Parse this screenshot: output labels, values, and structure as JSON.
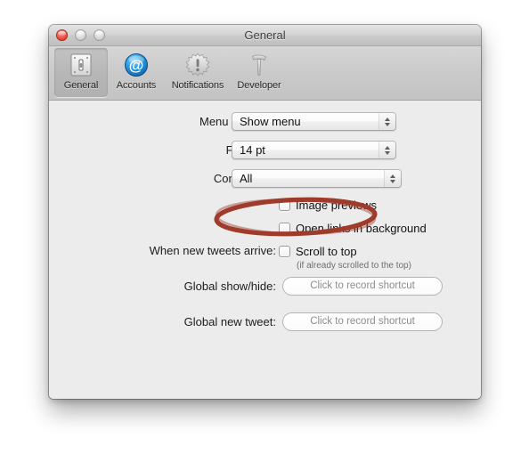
{
  "window": {
    "title": "General",
    "traffic_lights": [
      {
        "name": "close",
        "color": "#d63a2c",
        "enabled": true
      },
      {
        "name": "minimize",
        "color": "#c6c6c6",
        "enabled": false
      },
      {
        "name": "zoom",
        "color": "#c6c6c6",
        "enabled": false
      }
    ]
  },
  "toolbar": {
    "items": [
      {
        "label": "General",
        "icon": "light-switch-icon",
        "selected": true
      },
      {
        "label": "Accounts",
        "icon": "at-sign-icon",
        "selected": false
      },
      {
        "label": "Notifications",
        "icon": "badge-exclamation-icon",
        "selected": false
      },
      {
        "label": "Developer",
        "icon": "hammer-icon",
        "selected": false
      }
    ]
  },
  "form": {
    "menu_bar_icon": {
      "label": "Menu bar icon:",
      "value": "Show menu",
      "options": [
        "Show menu"
      ]
    },
    "font_size": {
      "label": "Font size:",
      "value": "14 pt",
      "options": [
        "14 pt"
      ]
    },
    "connect_tab": {
      "label": "Connect tab",
      "value": "All",
      "options": [
        "All"
      ]
    },
    "image_previews": {
      "label": "Image previews",
      "checked": false
    },
    "open_links_background": {
      "label": "Open links in background",
      "checked": false
    },
    "new_tweets": {
      "label": "When new tweets arrive:",
      "checkbox_label": "Scroll to top",
      "checked": false,
      "note": "(if already scrolled to the top)"
    },
    "global_show_hide": {
      "label": "Global show/hide:",
      "placeholder": "Click to record shortcut"
    },
    "global_new_tweet": {
      "label": "Global new tweet:",
      "placeholder": "Click to record shortcut"
    }
  },
  "annotation": {
    "shape": "ellipse",
    "color": "#9e3b2a",
    "target": "Image previews"
  }
}
